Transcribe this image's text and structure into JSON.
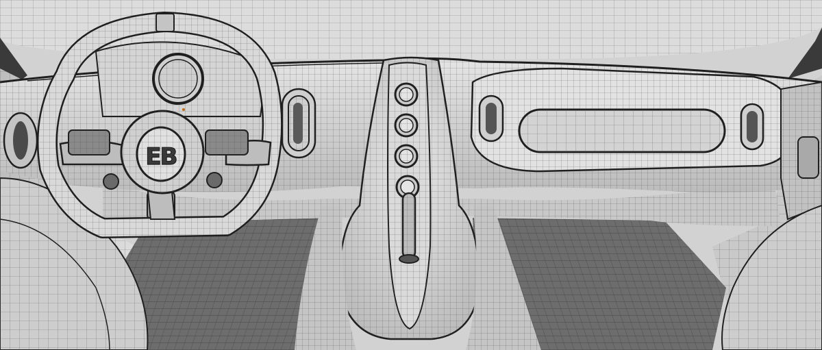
{
  "scene": {
    "kind": "wireframe-render",
    "subject": "car-interior-dashboard",
    "palette": {
      "surface": "#d8d8d8",
      "surface_light": "#e6e6e6",
      "surface_dark": "#bdbdbd",
      "shadow": "#9a9a9a",
      "floor": "#6f6f6f",
      "floor_dark": "#595959",
      "wire": "#4a4a4a",
      "edge": "#1f1f1f"
    }
  },
  "steering_wheel": {
    "badge_text": "EB",
    "badge_shape": "oval-logo"
  },
  "center_console": {
    "knob_count": 5,
    "has_gear_lever": true
  },
  "dashboard": {
    "vent_count": 4,
    "has_glovebox_panel": true
  }
}
